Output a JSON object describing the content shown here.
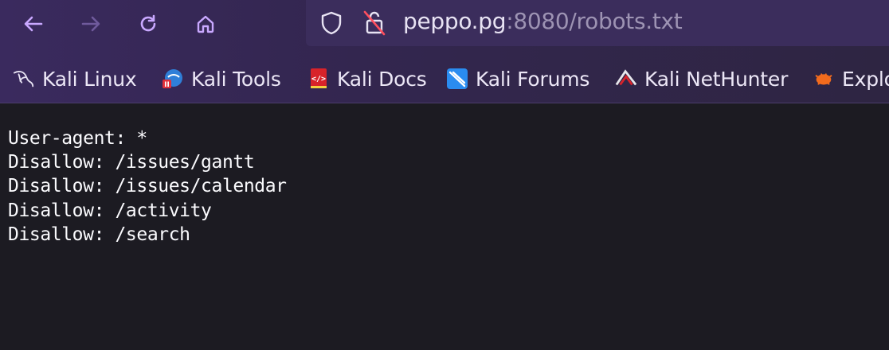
{
  "browser": {
    "url": {
      "host": "peppo.pg",
      "rest": ":8080/robots.txt"
    },
    "nav_icons": [
      "back-arrow-icon",
      "forward-arrow-icon",
      "reload-icon",
      "home-icon"
    ],
    "url_icons": [
      "shield-icon",
      "insecure-lock-icon"
    ]
  },
  "bookmarks": [
    {
      "label": "Kali Linux",
      "icon": "kali-dragon-icon"
    },
    {
      "label": "Kali Tools",
      "icon": "kali-tools-icon"
    },
    {
      "label": "Kali Docs",
      "icon": "kali-docs-icon"
    },
    {
      "label": "Kali Forums",
      "icon": "kali-forums-icon"
    },
    {
      "label": "Kali NetHunter",
      "icon": "nethunter-icon"
    },
    {
      "label": "Explo",
      "icon": "exploit-db-icon"
    }
  ],
  "content": {
    "lines": [
      "User-agent: *",
      "Disallow: /issues/gantt",
      "Disallow: /issues/calendar",
      "Disallow: /activity",
      "Disallow: /search"
    ]
  },
  "colors": {
    "toolbar": "#3a2a5e",
    "urlbar": "#3b2d5c",
    "accent": "#c9a8ff",
    "content_bg": "#1c1b22",
    "text": "#fbfbfe"
  }
}
